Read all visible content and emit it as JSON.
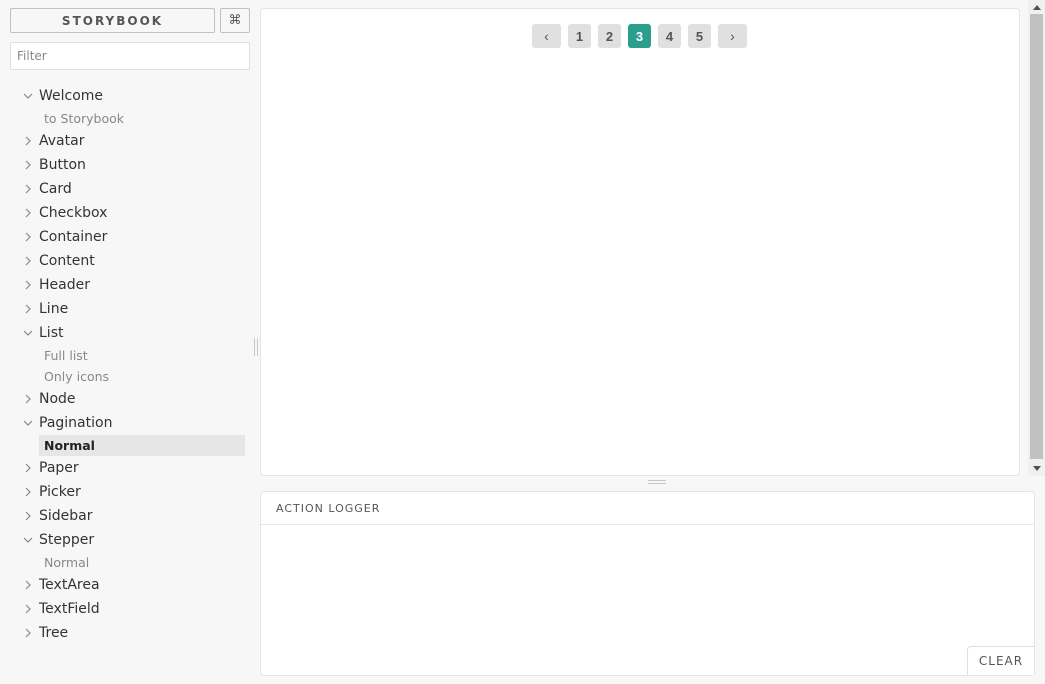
{
  "sidebar": {
    "brand": "STORYBOOK",
    "shortcut_icon": "⌘",
    "filter_placeholder": "Filter",
    "kinds": [
      {
        "label": "Welcome",
        "expanded": true,
        "stories": [
          {
            "label": "to Storybook",
            "active": false
          }
        ]
      },
      {
        "label": "Avatar",
        "expanded": false,
        "stories": []
      },
      {
        "label": "Button",
        "expanded": false,
        "stories": []
      },
      {
        "label": "Card",
        "expanded": false,
        "stories": []
      },
      {
        "label": "Checkbox",
        "expanded": false,
        "stories": []
      },
      {
        "label": "Container",
        "expanded": false,
        "stories": []
      },
      {
        "label": "Content",
        "expanded": false,
        "stories": []
      },
      {
        "label": "Header",
        "expanded": false,
        "stories": []
      },
      {
        "label": "Line",
        "expanded": false,
        "stories": []
      },
      {
        "label": "List",
        "expanded": true,
        "stories": [
          {
            "label": "Full list",
            "active": false
          },
          {
            "label": "Only icons",
            "active": false
          }
        ]
      },
      {
        "label": "Node",
        "expanded": false,
        "stories": []
      },
      {
        "label": "Pagination",
        "expanded": true,
        "stories": [
          {
            "label": "Normal",
            "active": true
          }
        ]
      },
      {
        "label": "Paper",
        "expanded": false,
        "stories": []
      },
      {
        "label": "Picker",
        "expanded": false,
        "stories": []
      },
      {
        "label": "Sidebar",
        "expanded": false,
        "stories": []
      },
      {
        "label": "Stepper",
        "expanded": true,
        "stories": [
          {
            "label": "Normal",
            "active": false
          }
        ]
      },
      {
        "label": "TextArea",
        "expanded": false,
        "stories": []
      },
      {
        "label": "TextField",
        "expanded": false,
        "stories": []
      },
      {
        "label": "Tree",
        "expanded": false,
        "stories": []
      }
    ]
  },
  "preview": {
    "pagination": {
      "prev_label": "‹",
      "next_label": "›",
      "pages": [
        "1",
        "2",
        "3",
        "4",
        "5"
      ],
      "current": "3",
      "accent_color": "#2c9e8e"
    }
  },
  "logger": {
    "tab_label": "ACTION LOGGER",
    "clear_label": "CLEAR"
  }
}
